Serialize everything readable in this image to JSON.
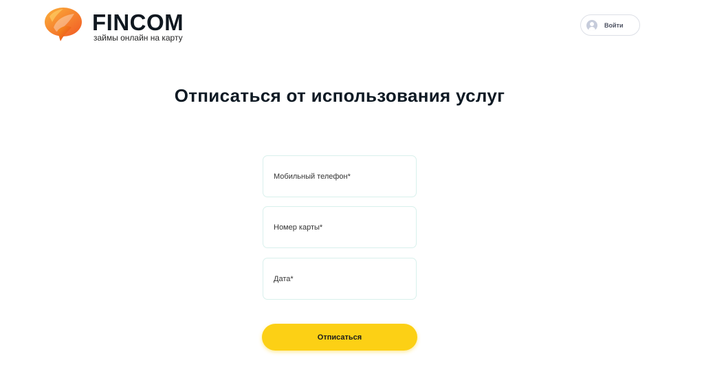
{
  "header": {
    "brand_name": "FINCOM",
    "tagline": "займы онлайн на карту",
    "login_label": "Войти"
  },
  "page": {
    "title": "Отписаться от использования услуг"
  },
  "form": {
    "phone_placeholder": "Мобильный телефон*",
    "card_placeholder": "Номер карты*",
    "date_placeholder": "Дата*",
    "submit_label": "Отписаться"
  },
  "colors": {
    "accent": "#fcd015",
    "field_border": "#d8f0ec",
    "logo_orange": "#f47b20"
  },
  "icons": {
    "logo": "speech-bubble-leaf-logo",
    "login": "user-avatar-icon"
  }
}
